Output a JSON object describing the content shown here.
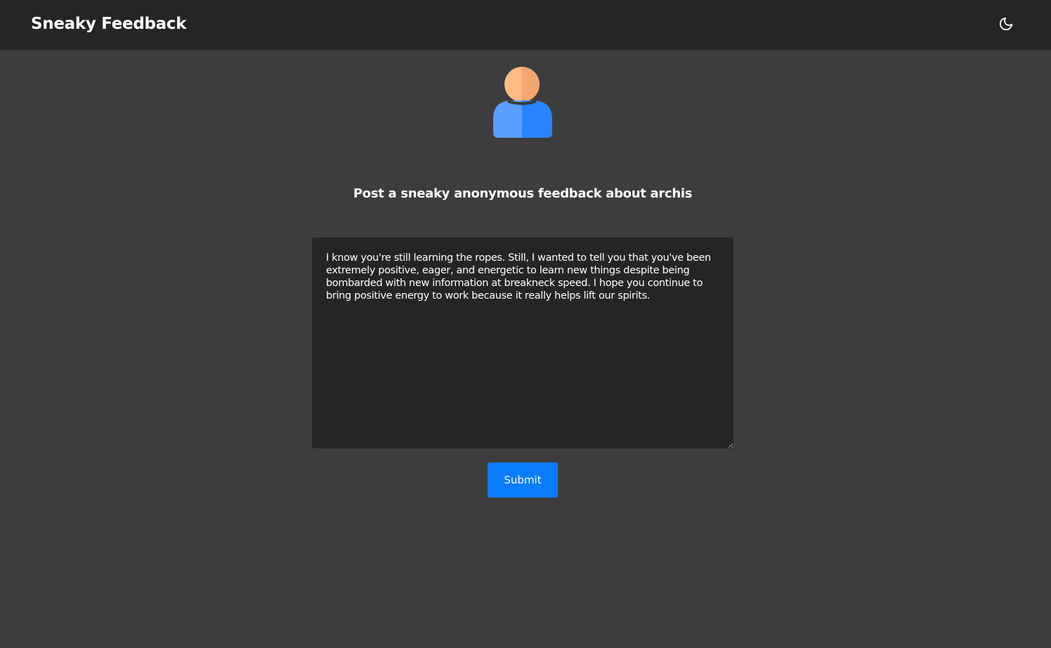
{
  "header": {
    "brand": "Sneaky Feedback",
    "theme_toggle_icon": "moon-icon"
  },
  "profile": {
    "avatar_icon": "user-avatar-icon",
    "colors": {
      "head_light": "#ffbb86",
      "head_dark": "#f5a670",
      "body_light": "#5a9fff",
      "body_dark": "#2a84ff"
    }
  },
  "main": {
    "heading": "Post a sneaky anonymous feedback about archis",
    "feedback_text": "I know you're still learning the ropes. Still, I wanted to tell you that you've been extremely positive, eager, and energetic to learn new things despite being bombarded with new information at breakneck speed. I hope you continue to bring positive energy to work because it really helps lift our spirits.",
    "submit_label": "Submit"
  },
  "colors": {
    "page_bg": "#3d3d3d",
    "navbar_bg": "#252525",
    "textarea_bg": "#252525",
    "accent": "#0a7cff"
  }
}
